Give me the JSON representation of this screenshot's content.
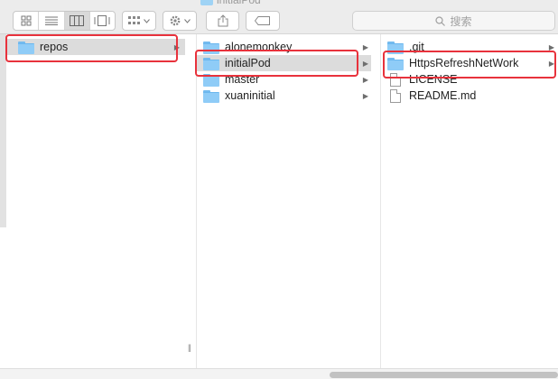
{
  "window": {
    "title": "initialPod"
  },
  "search": {
    "placeholder": "搜索"
  },
  "columns": [
    {
      "items": [
        {
          "label": "repos",
          "type": "folder",
          "selected": true
        }
      ]
    },
    {
      "items": [
        {
          "label": "alonemonkey",
          "type": "folder"
        },
        {
          "label": "initialPod",
          "type": "folder",
          "selected": true
        },
        {
          "label": "master",
          "type": "folder"
        },
        {
          "label": "xuaninitial",
          "type": "folder"
        }
      ]
    },
    {
      "items": [
        {
          "label": ".git",
          "type": "folder"
        },
        {
          "label": "HttpsRefreshNetWork",
          "type": "folder"
        },
        {
          "label": "LICENSE",
          "type": "file"
        },
        {
          "label": "README.md",
          "type": "file"
        }
      ]
    }
  ],
  "colors": {
    "highlight": "#e8323c",
    "folder": "#8fccf7",
    "selection": "#dcdcdc"
  }
}
